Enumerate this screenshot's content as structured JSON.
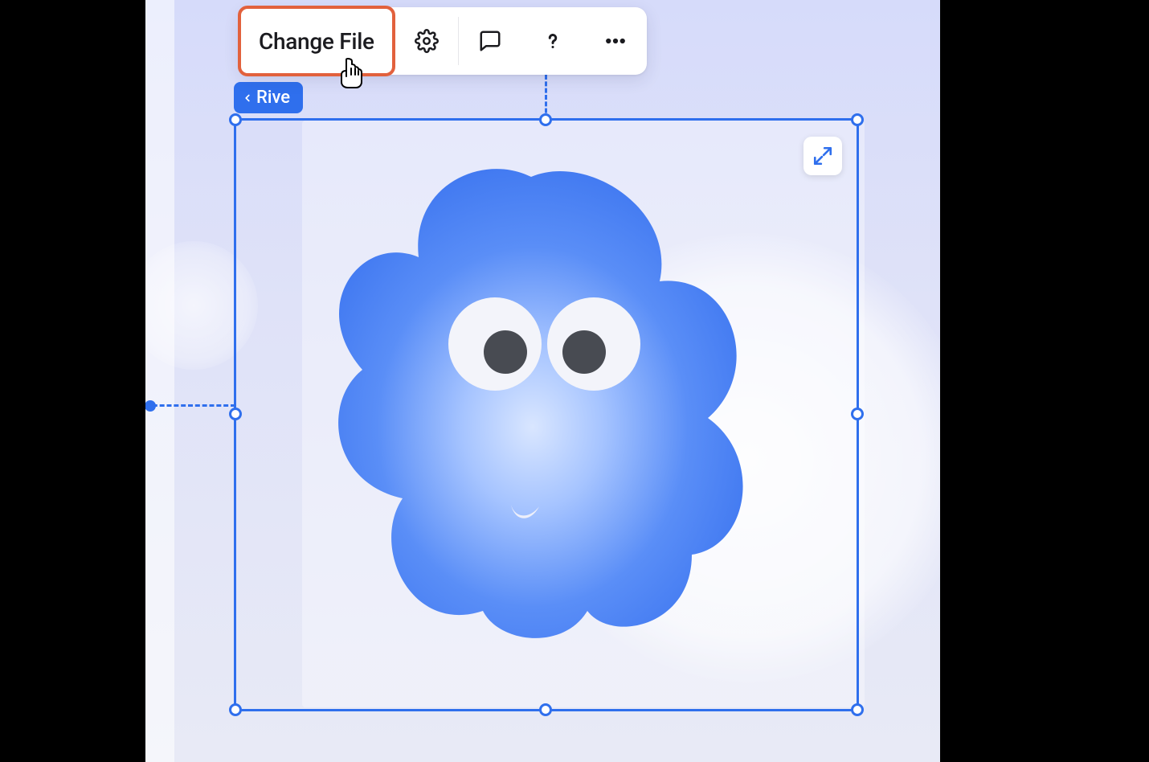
{
  "toolbar": {
    "change_file_label": "Change File",
    "icons": {
      "settings": "gear-icon",
      "comment": "comment-icon",
      "help": "question-icon",
      "more": "more-icon"
    }
  },
  "element_tag": {
    "label": "Rive"
  },
  "selection": {
    "expand_icon": "expand-icon"
  },
  "colors": {
    "accent": "#2f6fed",
    "highlight_border": "#e2613d",
    "blob_fill_outer": "#3d7bf5",
    "blob_fill_inner": "#bcd5ff",
    "eye_white": "#f5f6fb",
    "eye_pupil": "#474a51"
  }
}
